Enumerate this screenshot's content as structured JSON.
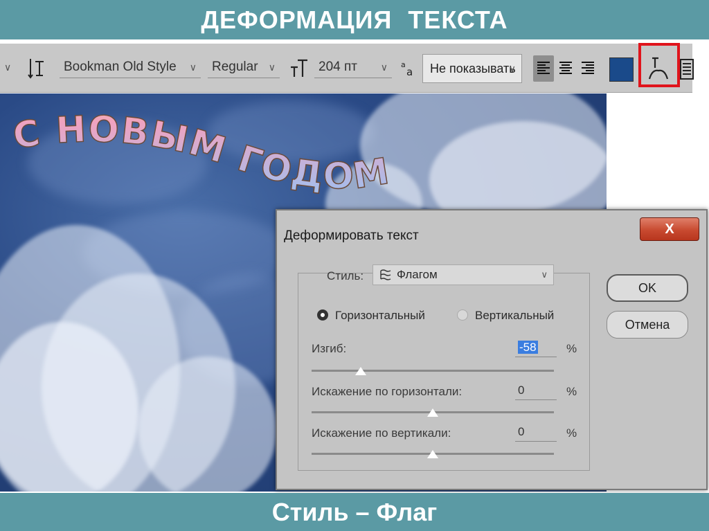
{
  "header": {
    "title": "ДЕФОРМАЦИЯ   ТЕКСТА"
  },
  "footer": {
    "caption": "Стиль – Флаг"
  },
  "toolbar": {
    "font_family": "Bookman Old Style",
    "font_style": "Regular",
    "font_size": "204 пт",
    "antialias": "Не показывать",
    "text_color": "#1a4a8a"
  },
  "canvas": {
    "text": "С НОВЫМ ГОДОМ !"
  },
  "dialog": {
    "title": "Деформировать текст",
    "close": "X",
    "style_label": "Стиль:",
    "style_value": "Флагом",
    "horizontal_label": "Горизонтальный",
    "vertical_label": "Вертикальный",
    "orientation_selected": "horizontal",
    "bend_label": "Изгиб:",
    "bend_value": "-58",
    "bend_unit": "%",
    "hdist_label": "Искажение по горизонтали:",
    "hdist_value": "0",
    "hdist_unit": "%",
    "vdist_label": "Искажение по вертикали:",
    "vdist_value": "0",
    "vdist_unit": "%",
    "ok_label": "OK",
    "cancel_label": "Отмена"
  },
  "colors": {
    "banner": "#5b9aa4",
    "highlight": "#e0141c"
  }
}
